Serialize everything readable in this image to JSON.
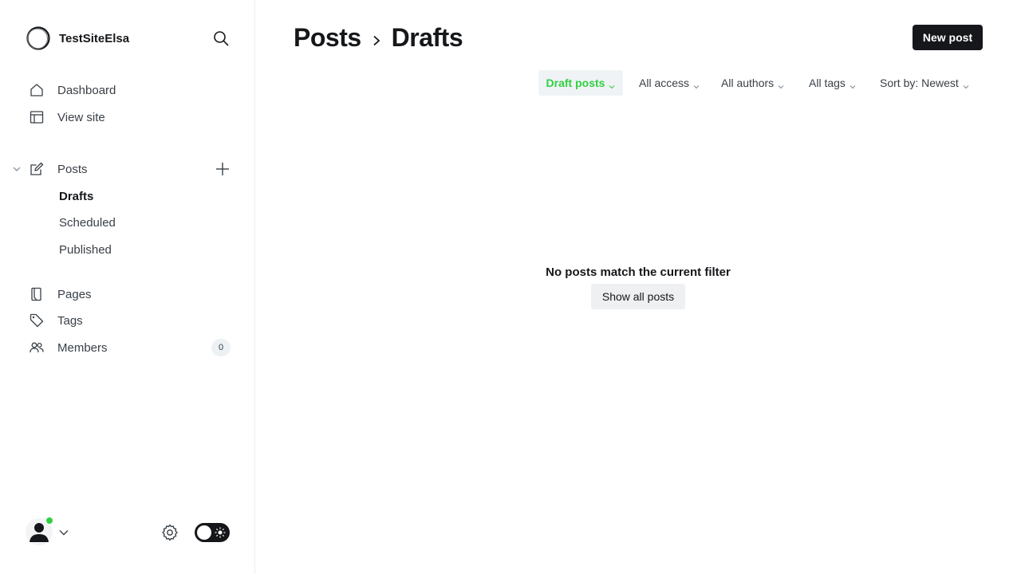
{
  "site": {
    "name": "TestSiteElsa"
  },
  "nav": {
    "primary": [
      {
        "label": "Dashboard",
        "icon": "home-icon"
      },
      {
        "label": "View site",
        "icon": "layout-icon"
      }
    ],
    "posts": {
      "label": "Posts",
      "icon": "edit-icon",
      "sub": [
        "Drafts",
        "Scheduled",
        "Published"
      ],
      "active_sub": "Drafts"
    },
    "secondary": [
      {
        "label": "Pages",
        "icon": "pages-icon"
      },
      {
        "label": "Tags",
        "icon": "tag-icon"
      },
      {
        "label": "Members",
        "icon": "members-icon",
        "count": "0"
      }
    ]
  },
  "header": {
    "crumb_parent": "Posts",
    "crumb_current": "Drafts",
    "new_post_label": "New post"
  },
  "filters": [
    {
      "label": "Draft posts",
      "active": true
    },
    {
      "label": "All access",
      "active": false
    },
    {
      "label": "All authors",
      "active": false
    },
    {
      "label": "All tags",
      "active": false
    },
    {
      "label": "Sort by: Newest",
      "active": false
    }
  ],
  "empty_state": {
    "message": "No posts match the current filter",
    "button_label": "Show all posts"
  },
  "colors": {
    "accent_green": "#30cf43",
    "dark": "#15171a",
    "muted_text": "#394047"
  }
}
